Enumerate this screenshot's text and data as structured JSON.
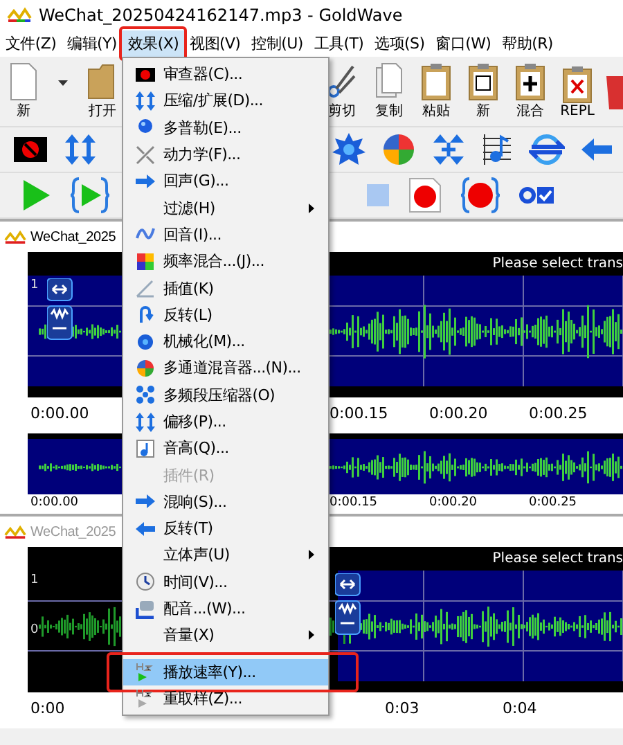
{
  "window": {
    "title": "WeChat_20250424162147.mp3 - GoldWave"
  },
  "menu_bar": [
    {
      "label": "文件(Z)",
      "selected": false,
      "annotated": false
    },
    {
      "label": "编辑(Y)",
      "selected": false,
      "annotated": false
    },
    {
      "label": "效果(X)",
      "selected": true,
      "annotated": true
    },
    {
      "label": "视图(V)",
      "selected": false,
      "annotated": false
    },
    {
      "label": "控制(U)",
      "selected": false,
      "annotated": false
    },
    {
      "label": "工具(T)",
      "selected": false,
      "annotated": false
    },
    {
      "label": "选项(S)",
      "selected": false,
      "annotated": false
    },
    {
      "label": "窗口(W)",
      "selected": false,
      "annotated": false
    },
    {
      "label": "帮助(R)",
      "selected": false,
      "annotated": false
    }
  ],
  "toolbar": {
    "left_buttons": [
      {
        "label": "新"
      },
      {
        "label": "打开"
      }
    ],
    "right_buttons": [
      {
        "label": "剪切"
      },
      {
        "label": "复制"
      },
      {
        "label": "粘贴"
      },
      {
        "label": "新"
      },
      {
        "label": "混合"
      },
      {
        "label": "REPL"
      }
    ]
  },
  "documents": [
    {
      "title": "WeChat_2025",
      "active": true,
      "status": "Please select trans",
      "channel_label": "1",
      "whole_selected": true,
      "ruler": [
        "0:00.00",
        "0:00.15",
        "0:00.20",
        "0:00.25"
      ],
      "overview_ruler": [
        "0:00.00",
        "0:00.15",
        "0:00.20",
        "0:00.25"
      ]
    },
    {
      "title": "WeChat_2025",
      "active": false,
      "status": "Please select trans",
      "channel_label": "1",
      "zero_label": "0",
      "whole_selected": false,
      "ruler": [
        "0:00",
        "0:03",
        "0:04"
      ]
    }
  ],
  "effects_menu": [
    {
      "label": "审查器(C)...",
      "kind": "action",
      "disabled": false,
      "selected": false,
      "annotated": false
    },
    {
      "label": "压缩/扩展(D)...",
      "kind": "action",
      "disabled": false,
      "selected": false,
      "annotated": false
    },
    {
      "label": "多普勒(E)...",
      "kind": "action",
      "disabled": false,
      "selected": false,
      "annotated": false
    },
    {
      "label": "动力学(F)...",
      "kind": "action",
      "disabled": false,
      "selected": false,
      "annotated": false
    },
    {
      "label": "回声(G)...",
      "kind": "action",
      "disabled": false,
      "selected": false,
      "annotated": false
    },
    {
      "label": "过滤(H)",
      "kind": "submenu",
      "disabled": false,
      "selected": false,
      "annotated": false
    },
    {
      "label": "回音(I)...",
      "kind": "action",
      "disabled": false,
      "selected": false,
      "annotated": false
    },
    {
      "label": "频率混合...(J)...",
      "kind": "action",
      "disabled": false,
      "selected": false,
      "annotated": false
    },
    {
      "label": "插值(K)",
      "kind": "action",
      "disabled": false,
      "selected": false,
      "annotated": false
    },
    {
      "label": "反转(L)",
      "kind": "action",
      "disabled": false,
      "selected": false,
      "annotated": false
    },
    {
      "label": "机械化(M)...",
      "kind": "action",
      "disabled": false,
      "selected": false,
      "annotated": false
    },
    {
      "label": "多通道混音器...(N)...",
      "kind": "action",
      "disabled": false,
      "selected": false,
      "annotated": false
    },
    {
      "label": "多频段压缩器(O)",
      "kind": "action",
      "disabled": false,
      "selected": false,
      "annotated": false
    },
    {
      "label": "偏移(P)...",
      "kind": "action",
      "disabled": false,
      "selected": false,
      "annotated": false
    },
    {
      "label": "音高(Q)...",
      "kind": "action",
      "disabled": false,
      "selected": false,
      "annotated": false
    },
    {
      "label": "插件(R)",
      "kind": "action",
      "disabled": true,
      "selected": false,
      "annotated": false
    },
    {
      "label": "混响(S)...",
      "kind": "action",
      "disabled": false,
      "selected": false,
      "annotated": false
    },
    {
      "label": "反转(T)",
      "kind": "action",
      "disabled": false,
      "selected": false,
      "annotated": false
    },
    {
      "label": "立体声(U)",
      "kind": "submenu",
      "disabled": false,
      "selected": false,
      "annotated": false
    },
    {
      "label": "时间(V)...",
      "kind": "action",
      "disabled": false,
      "selected": false,
      "annotated": false
    },
    {
      "label": "配音...(W)...",
      "kind": "action",
      "disabled": false,
      "selected": false,
      "annotated": false
    },
    {
      "label": "音量(X)",
      "kind": "submenu",
      "disabled": false,
      "selected": false,
      "annotated": false
    },
    {
      "kind": "separator"
    },
    {
      "label": "播放速率(Y)...",
      "kind": "action",
      "disabled": false,
      "selected": true,
      "annotated": true
    },
    {
      "label": "重取样(Z)...",
      "kind": "action",
      "disabled": false,
      "selected": false,
      "annotated": false
    }
  ]
}
